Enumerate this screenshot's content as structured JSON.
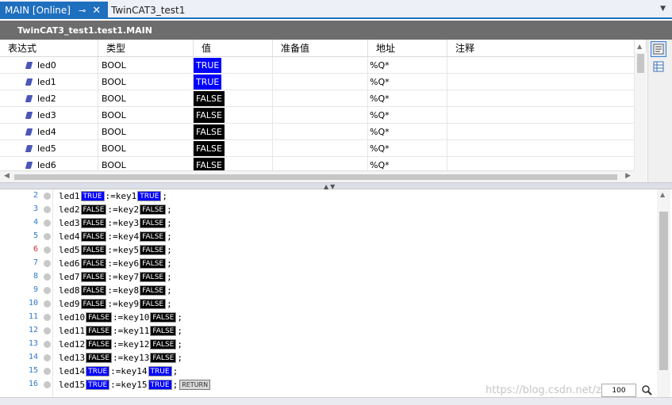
{
  "tabs": {
    "active_label": "MAIN [Online]",
    "pin_glyph": "⊸",
    "close_glyph": "✕",
    "inactive_label": "TwinCAT3_test1",
    "dropdown_glyph": "▼"
  },
  "header": {
    "path": "TwinCAT3_test1.test1.MAIN"
  },
  "watch": {
    "columns": [
      "表达式",
      "类型",
      "值",
      "准备值",
      "地址",
      "注释"
    ],
    "rows": [
      {
        "name": "led0",
        "type": "BOOL",
        "value": "TRUE",
        "prepared": "",
        "address": "%Q*",
        "comment": ""
      },
      {
        "name": "led1",
        "type": "BOOL",
        "value": "TRUE",
        "prepared": "",
        "address": "%Q*",
        "comment": ""
      },
      {
        "name": "led2",
        "type": "BOOL",
        "value": "FALSE",
        "prepared": "",
        "address": "%Q*",
        "comment": ""
      },
      {
        "name": "led3",
        "type": "BOOL",
        "value": "FALSE",
        "prepared": "",
        "address": "%Q*",
        "comment": ""
      },
      {
        "name": "led4",
        "type": "BOOL",
        "value": "FALSE",
        "prepared": "",
        "address": "%Q*",
        "comment": ""
      },
      {
        "name": "led5",
        "type": "BOOL",
        "value": "FALSE",
        "prepared": "",
        "address": "%Q*",
        "comment": ""
      },
      {
        "name": "led6",
        "type": "BOOL",
        "value": "FALSE",
        "prepared": "",
        "address": "%Q*",
        "comment": ""
      }
    ]
  },
  "side_tools": [
    "declaration-view-icon",
    "table-view-icon"
  ],
  "colors": {
    "true_bg": "#0000ff",
    "false_bg": "#000000",
    "tab_active": "#1f6fbf",
    "header_strip": "#6d6d6d"
  },
  "editor": {
    "lines": [
      {
        "num": "2",
        "left": "led1",
        "lval": "TRUE",
        "op": ":=",
        "right": "key1",
        "rval": "TRUE",
        "end": ";"
      },
      {
        "num": "3",
        "left": "led2",
        "lval": "FALSE",
        "op": ":=",
        "right": "key2",
        "rval": "FALSE",
        "end": ";"
      },
      {
        "num": "4",
        "left": "led3",
        "lval": "FALSE",
        "op": ":=",
        "right": "key3",
        "rval": "FALSE",
        "end": ";"
      },
      {
        "num": "5",
        "left": "led4",
        "lval": "FALSE",
        "op": ":=",
        "right": "key4",
        "rval": "FALSE",
        "end": ";"
      },
      {
        "num": "6",
        "left": "led5",
        "lval": "FALSE",
        "op": ":=",
        "right": "key5",
        "rval": "FALSE",
        "end": ";"
      },
      {
        "num": "7",
        "left": "led6",
        "lval": "FALSE",
        "op": ":=",
        "right": "key6",
        "rval": "FALSE",
        "end": ";"
      },
      {
        "num": "8",
        "left": "led7",
        "lval": "FALSE",
        "op": ":=",
        "right": "key7",
        "rval": "FALSE",
        "end": ";"
      },
      {
        "num": "9",
        "left": "led8",
        "lval": "FALSE",
        "op": ":=",
        "right": "key8",
        "rval": "FALSE",
        "end": ";"
      },
      {
        "num": "10",
        "left": "led9",
        "lval": "FALSE",
        "op": ":=",
        "right": "key9",
        "rval": "FALSE",
        "end": ";"
      },
      {
        "num": "11",
        "left": "led10",
        "lval": "FALSE",
        "op": ":=",
        "right": "key10",
        "rval": "FALSE",
        "end": ";"
      },
      {
        "num": "12",
        "left": "led11",
        "lval": "FALSE",
        "op": ":=",
        "right": "key11",
        "rval": "FALSE",
        "end": ";"
      },
      {
        "num": "13",
        "left": "led12",
        "lval": "FALSE",
        "op": ":=",
        "right": "key12",
        "rval": "FALSE",
        "end": ";"
      },
      {
        "num": "14",
        "left": "led13",
        "lval": "FALSE",
        "op": ":=",
        "right": "key13",
        "rval": "FALSE",
        "end": ";"
      },
      {
        "num": "15",
        "left": "led14",
        "lval": "TRUE",
        "op": ":=",
        "right": "key14",
        "rval": "TRUE",
        "end": ";"
      },
      {
        "num": "16",
        "left": "led15",
        "lval": "TRUE",
        "op": ":=",
        "right": "key15",
        "rval": "TRUE",
        "end": ";"
      }
    ],
    "return_label": "RETURN",
    "zoom_value": "100",
    "watermark": "https://blog.csdn.net/zh"
  }
}
